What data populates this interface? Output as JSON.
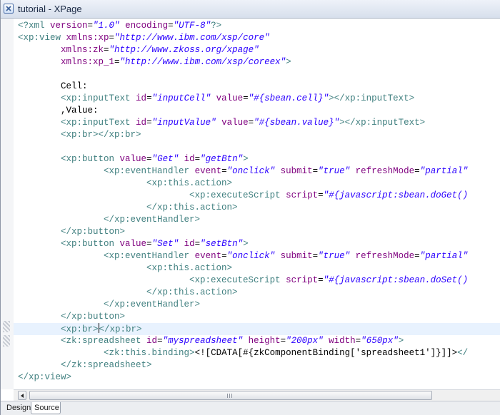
{
  "window": {
    "title": "tutorial - XPage"
  },
  "editor": {
    "lines": [
      [
        {
          "c": "pi",
          "t": "<?xml "
        },
        {
          "c": "attr",
          "t": "version"
        },
        {
          "c": "text",
          "t": "="
        },
        {
          "c": "val",
          "t": "\"1.0\""
        },
        {
          "c": "attr",
          "t": " encoding"
        },
        {
          "c": "text",
          "t": "="
        },
        {
          "c": "val",
          "t": "\"UTF-8\""
        },
        {
          "c": "pi",
          "t": "?>"
        }
      ],
      [
        {
          "c": "tag",
          "t": "<xp:view "
        },
        {
          "c": "attr",
          "t": "xmlns:xp"
        },
        {
          "c": "text",
          "t": "="
        },
        {
          "c": "val",
          "t": "\"http://www.ibm.com/xsp/core\""
        }
      ],
      [
        {
          "c": "text",
          "t": "        "
        },
        {
          "c": "attr",
          "t": "xmlns:zk"
        },
        {
          "c": "text",
          "t": "="
        },
        {
          "c": "val",
          "t": "\"http://www.zkoss.org/xpage\""
        }
      ],
      [
        {
          "c": "text",
          "t": "        "
        },
        {
          "c": "attr",
          "t": "xmlns:xp_1"
        },
        {
          "c": "text",
          "t": "="
        },
        {
          "c": "val",
          "t": "\"http://www.ibm.com/xsp/coreex\""
        },
        {
          "c": "tag",
          "t": ">"
        }
      ],
      [],
      [
        {
          "c": "text",
          "t": "        Cell:"
        }
      ],
      [
        {
          "c": "text",
          "t": "        "
        },
        {
          "c": "tag",
          "t": "<xp:inputText "
        },
        {
          "c": "attr",
          "t": "id"
        },
        {
          "c": "text",
          "t": "="
        },
        {
          "c": "val",
          "t": "\"inputCell\""
        },
        {
          "c": "attr",
          "t": " value"
        },
        {
          "c": "text",
          "t": "="
        },
        {
          "c": "val",
          "t": "\"#{sbean.cell}\""
        },
        {
          "c": "tag",
          "t": "></xp:inputText>"
        }
      ],
      [
        {
          "c": "text",
          "t": "        ,Value:"
        }
      ],
      [
        {
          "c": "text",
          "t": "        "
        },
        {
          "c": "tag",
          "t": "<xp:inputText "
        },
        {
          "c": "attr",
          "t": "id"
        },
        {
          "c": "text",
          "t": "="
        },
        {
          "c": "val",
          "t": "\"inputValue\""
        },
        {
          "c": "attr",
          "t": " value"
        },
        {
          "c": "text",
          "t": "="
        },
        {
          "c": "val",
          "t": "\"#{sbean.value}\""
        },
        {
          "c": "tag",
          "t": "></xp:inputText>"
        }
      ],
      [
        {
          "c": "text",
          "t": "        "
        },
        {
          "c": "tag",
          "t": "<xp:br></xp:br>"
        }
      ],
      [],
      [
        {
          "c": "text",
          "t": "        "
        },
        {
          "c": "tag",
          "t": "<xp:button "
        },
        {
          "c": "attr",
          "t": "value"
        },
        {
          "c": "text",
          "t": "="
        },
        {
          "c": "val",
          "t": "\"Get\""
        },
        {
          "c": "attr",
          "t": " id"
        },
        {
          "c": "text",
          "t": "="
        },
        {
          "c": "val",
          "t": "\"getBtn\""
        },
        {
          "c": "tag",
          "t": ">"
        }
      ],
      [
        {
          "c": "text",
          "t": "                "
        },
        {
          "c": "tag",
          "t": "<xp:eventHandler "
        },
        {
          "c": "attr",
          "t": "event"
        },
        {
          "c": "text",
          "t": "="
        },
        {
          "c": "val",
          "t": "\"onclick\""
        },
        {
          "c": "attr",
          "t": " submit"
        },
        {
          "c": "text",
          "t": "="
        },
        {
          "c": "val",
          "t": "\"true\""
        },
        {
          "c": "attr",
          "t": " refreshMode"
        },
        {
          "c": "text",
          "t": "="
        },
        {
          "c": "val",
          "t": "\"partial\""
        }
      ],
      [
        {
          "c": "text",
          "t": "                        "
        },
        {
          "c": "tag",
          "t": "<xp:this.action>"
        }
      ],
      [
        {
          "c": "text",
          "t": "                                "
        },
        {
          "c": "tag",
          "t": "<xp:executeScript "
        },
        {
          "c": "attr",
          "t": "script"
        },
        {
          "c": "text",
          "t": "="
        },
        {
          "c": "val",
          "t": "\"#{javascript:sbean.doGet()"
        }
      ],
      [
        {
          "c": "text",
          "t": "                        "
        },
        {
          "c": "tag",
          "t": "</xp:this.action>"
        }
      ],
      [
        {
          "c": "text",
          "t": "                "
        },
        {
          "c": "tag",
          "t": "</xp:eventHandler>"
        }
      ],
      [
        {
          "c": "text",
          "t": "        "
        },
        {
          "c": "tag",
          "t": "</xp:button>"
        }
      ],
      [
        {
          "c": "text",
          "t": "        "
        },
        {
          "c": "tag",
          "t": "<xp:button "
        },
        {
          "c": "attr",
          "t": "value"
        },
        {
          "c": "text",
          "t": "="
        },
        {
          "c": "val",
          "t": "\"Set\""
        },
        {
          "c": "attr",
          "t": " id"
        },
        {
          "c": "text",
          "t": "="
        },
        {
          "c": "val",
          "t": "\"setBtn\""
        },
        {
          "c": "tag",
          "t": ">"
        }
      ],
      [
        {
          "c": "text",
          "t": "                "
        },
        {
          "c": "tag",
          "t": "<xp:eventHandler "
        },
        {
          "c": "attr",
          "t": "event"
        },
        {
          "c": "text",
          "t": "="
        },
        {
          "c": "val",
          "t": "\"onclick\""
        },
        {
          "c": "attr",
          "t": " submit"
        },
        {
          "c": "text",
          "t": "="
        },
        {
          "c": "val",
          "t": "\"true\""
        },
        {
          "c": "attr",
          "t": " refreshMode"
        },
        {
          "c": "text",
          "t": "="
        },
        {
          "c": "val",
          "t": "\"partial\""
        }
      ],
      [
        {
          "c": "text",
          "t": "                        "
        },
        {
          "c": "tag",
          "t": "<xp:this.action>"
        }
      ],
      [
        {
          "c": "text",
          "t": "                                "
        },
        {
          "c": "tag",
          "t": "<xp:executeScript "
        },
        {
          "c": "attr",
          "t": "script"
        },
        {
          "c": "text",
          "t": "="
        },
        {
          "c": "val",
          "t": "\"#{javascript:sbean.doSet()"
        }
      ],
      [
        {
          "c": "text",
          "t": "                        "
        },
        {
          "c": "tag",
          "t": "</xp:this.action>"
        }
      ],
      [
        {
          "c": "text",
          "t": "                "
        },
        {
          "c": "tag",
          "t": "</xp:eventHandler>"
        }
      ],
      [
        {
          "c": "text",
          "t": "        "
        },
        {
          "c": "tag",
          "t": "</xp:button>"
        }
      ],
      [
        {
          "c": "text",
          "t": "        "
        },
        {
          "c": "tag",
          "t": "<xp:br>"
        },
        {
          "c": "cursor",
          "t": ""
        },
        {
          "c": "tag",
          "t": "</xp:br>"
        }
      ],
      [
        {
          "c": "text",
          "t": "        "
        },
        {
          "c": "tag",
          "t": "<zk:spreadsheet "
        },
        {
          "c": "attr",
          "t": "id"
        },
        {
          "c": "text",
          "t": "="
        },
        {
          "c": "val",
          "t": "\"myspreadsheet\""
        },
        {
          "c": "attr",
          "t": " height"
        },
        {
          "c": "text",
          "t": "="
        },
        {
          "c": "val",
          "t": "\"200px\""
        },
        {
          "c": "attr",
          "t": " width"
        },
        {
          "c": "text",
          "t": "="
        },
        {
          "c": "val",
          "t": "\"650px\""
        },
        {
          "c": "tag",
          "t": ">"
        }
      ],
      [
        {
          "c": "text",
          "t": "                "
        },
        {
          "c": "tag",
          "t": "<zk:this.binding>"
        },
        {
          "c": "text",
          "t": "<![CDATA[#{zkComponentBinding['spreadsheet1']}]]>"
        },
        {
          "c": "tag",
          "t": "</"
        }
      ],
      [
        {
          "c": "text",
          "t": "        "
        },
        {
          "c": "tag",
          "t": "</zk:spreadsheet>"
        }
      ],
      [
        {
          "c": "tag",
          "t": "</xp:view>"
        }
      ]
    ],
    "current_line": 25
  },
  "tabs": {
    "design": "Design",
    "source": "Source"
  }
}
